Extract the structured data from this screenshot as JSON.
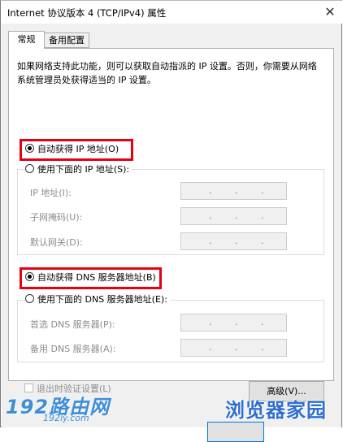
{
  "window": {
    "title": "Internet 协议版本 4 (TCP/IPv4) 属性",
    "close_glyph": "✕"
  },
  "tabs": [
    {
      "label": "常规",
      "active": true
    },
    {
      "label": "备用配置",
      "active": false
    }
  ],
  "description": "如果网络支持此功能，则可以获取自动指派的 IP 设置。否则，你需要从网络系统管理员处获得适当的 IP 设置。",
  "ip": {
    "auto_label": "自动获得 IP 地址(O)",
    "manual_label": "使用下面的 IP 地址(S):",
    "selected": "auto",
    "fields": [
      {
        "label": "IP 地址(I):",
        "value": ". . ."
      },
      {
        "label": "子网掩码(U):",
        "value": ". . ."
      },
      {
        "label": "默认网关(D):",
        "value": ". . ."
      }
    ]
  },
  "dns": {
    "auto_label": "自动获得 DNS 服务器地址(B)",
    "manual_label": "使用下面的 DNS 服务器地址(E):",
    "selected": "auto",
    "fields": [
      {
        "label": "首选 DNS 服务器(P):",
        "value": ". . ."
      },
      {
        "label": "备用 DNS 服务器(A):",
        "value": ". . ."
      }
    ]
  },
  "validate_checkbox": {
    "label": "退出时验证设置(L)",
    "checked": false,
    "enabled": false
  },
  "advanced_button": "高级(V)...",
  "watermarks": {
    "left_big": "192路由网",
    "left_small": "192ly.com",
    "right": "浏览器家园"
  },
  "colors": {
    "highlight_border": "#e60012",
    "accent": "#0078d7"
  }
}
